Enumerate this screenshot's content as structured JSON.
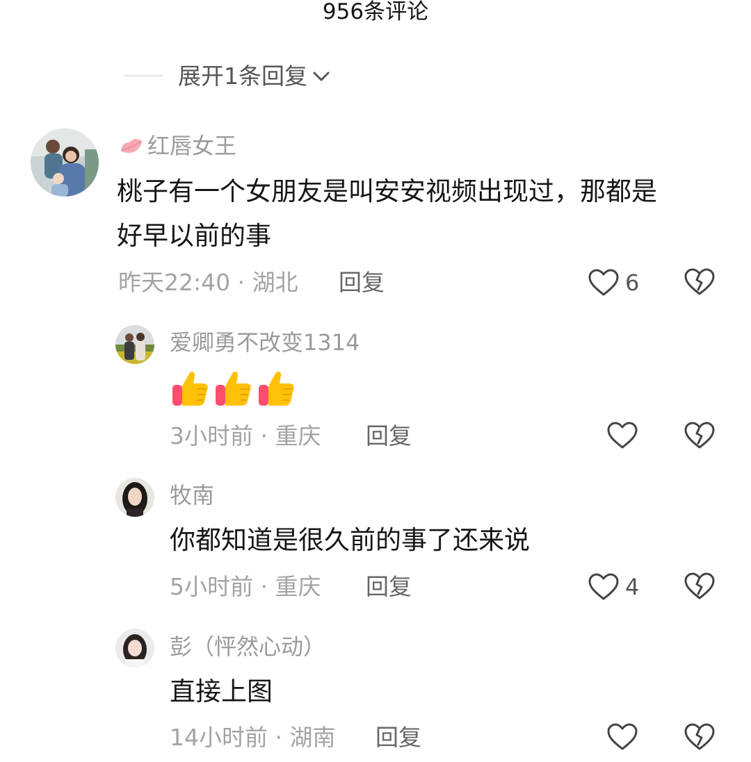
{
  "header": {
    "title": "956条评论"
  },
  "expand": {
    "label": "展开1条回复"
  },
  "comments": [
    {
      "name": "红唇女王",
      "text_line1": "桃子有一个女朋友是叫安安视频出现过，那都是",
      "text_line2": "好早以前的事",
      "time": "昨天22:40",
      "location": "湖北",
      "reply": "回复",
      "likes": "6"
    },
    {
      "name": "爱卿勇不改变1314",
      "text": "",
      "emoji_count": 3,
      "time": "3小时前",
      "location": "重庆",
      "reply": "回复",
      "likes": ""
    },
    {
      "name": "牧南",
      "text": "你都知道是很久前的事了还来说",
      "time": "5小时前",
      "location": "重庆",
      "reply": "回复",
      "likes": "4"
    },
    {
      "name": "彭（怦然心动）",
      "text": "直接上图",
      "time": "14小时前",
      "location": "湖南",
      "reply": "回复",
      "likes": ""
    }
  ],
  "colors": {
    "meta": "#a3a3a3",
    "name": "#9a9a9a",
    "lips": "#f6a9b3",
    "thumb": "#ffc107",
    "cuff": "#ff4d6d"
  }
}
